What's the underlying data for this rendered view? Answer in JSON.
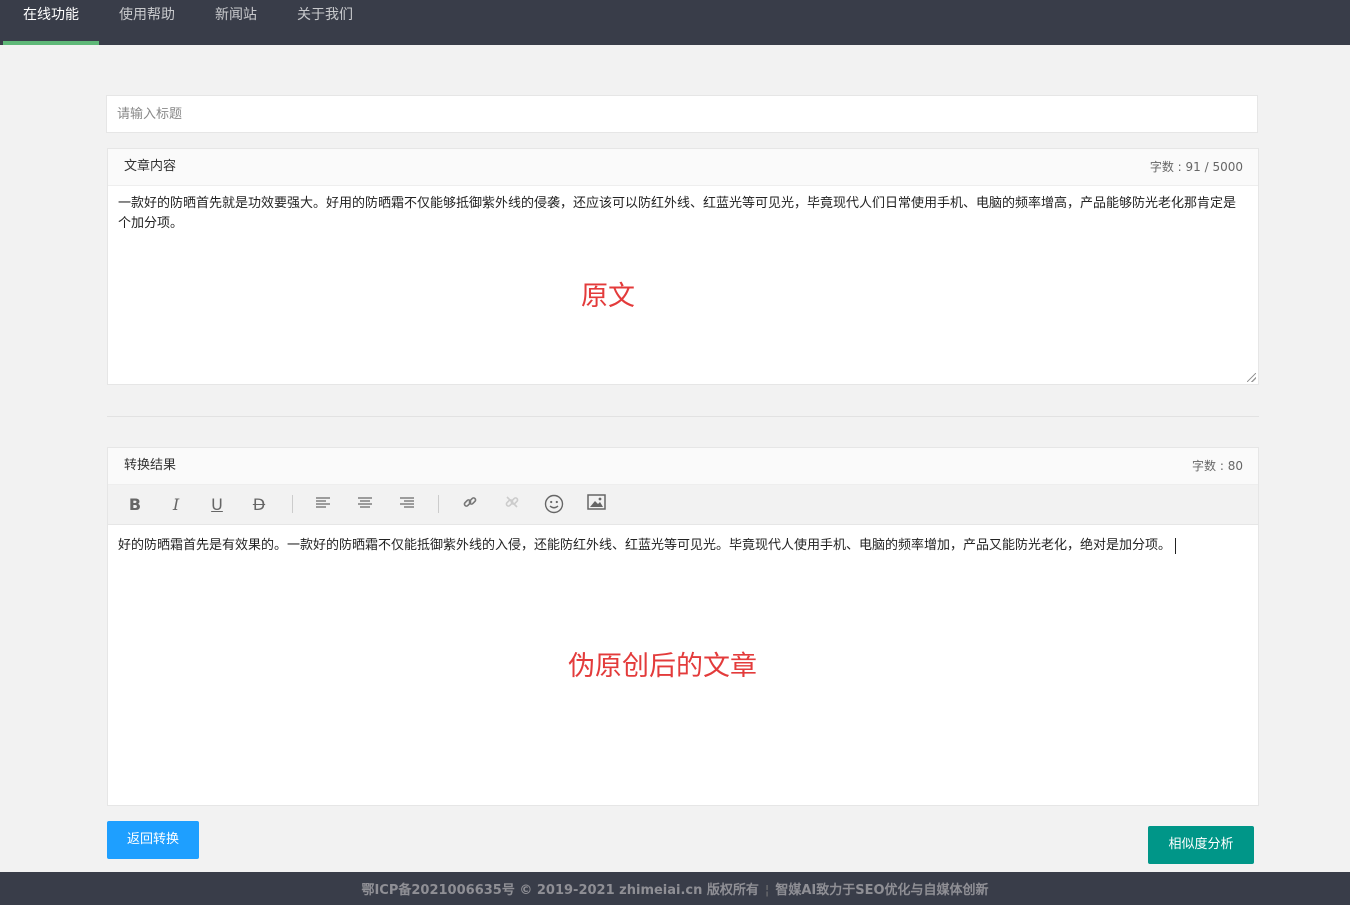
{
  "nav": {
    "items": [
      {
        "label": "在线功能",
        "active": true
      },
      {
        "label": "使用帮助",
        "active": false
      },
      {
        "label": "新闻站",
        "active": false
      },
      {
        "label": "关于我们",
        "active": false
      }
    ],
    "active_color": "#5fb878"
  },
  "title_input": {
    "placeholder": "请输入标题",
    "value": ""
  },
  "original": {
    "header": "文章内容",
    "count": "字数 : 91 / 5000",
    "text": "一款好的防晒首先就是功效要强大。好用的防晒霜不仅能够抵御紫外线的侵袭，还应该可以防红外线、红蓝光等可见光，毕竟现代人们日常使用手机、电脑的频率增高，产品能够防光老化那肯定是个加分项。",
    "annotation": "原文"
  },
  "result": {
    "header": "转换结果",
    "count": "字数 : 80",
    "text": "好的防晒霜首先是有效果的。一款好的防晒霜不仅能抵御紫外线的入侵，还能防红外线、红蓝光等可见光。毕竟现代人使用手机、电脑的频率增加，产品又能防光老化，绝对是加分项。",
    "annotation": "伪原创后的文章",
    "toolbar": [
      "bold-icon",
      "italic-icon",
      "underline-icon",
      "strikethrough-icon",
      "align-left-icon",
      "align-center-icon",
      "align-right-icon",
      "link-icon",
      "unlink-icon",
      "emoji-icon",
      "image-icon"
    ]
  },
  "buttons": {
    "back": {
      "label": "返回转换",
      "color": "#1e9fff"
    },
    "similarity": {
      "label": "相似度分析",
      "color": "#009688"
    }
  },
  "footer": {
    "left": "鄂ICP备2021006635号 © 2019-2021 zhimeiai.cn 版权所有",
    "right": "智媒AI致力于SEO优化与自媒体创新"
  }
}
